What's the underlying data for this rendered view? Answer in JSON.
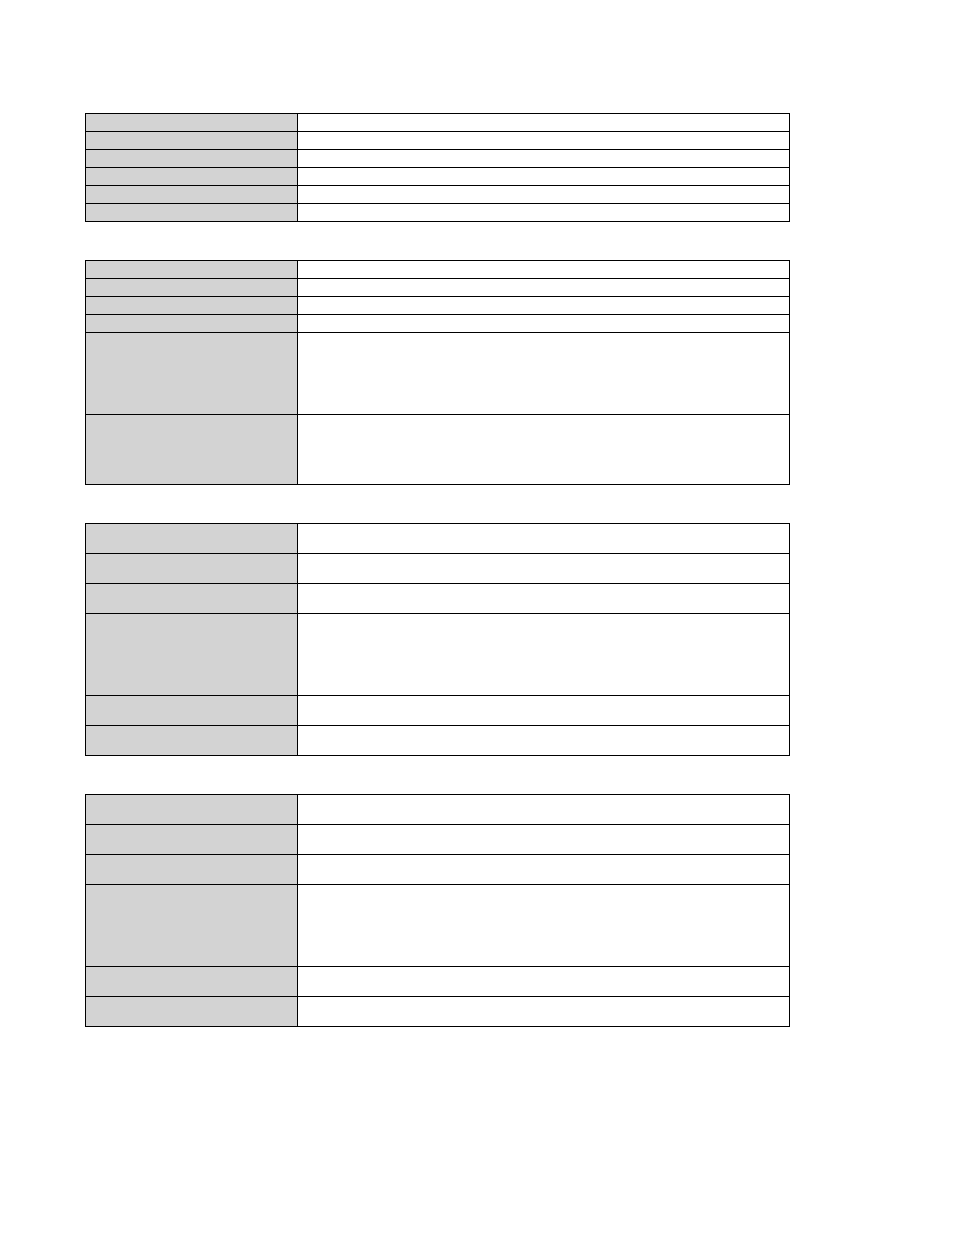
{
  "table1": {
    "rows": [
      {
        "label": "",
        "value": ""
      },
      {
        "label": "",
        "value": ""
      },
      {
        "label": "",
        "value": ""
      },
      {
        "label": "",
        "value": ""
      },
      {
        "label": "",
        "value": ""
      },
      {
        "label": "",
        "value": ""
      }
    ]
  },
  "table2": {
    "rows": [
      {
        "label": "",
        "value": ""
      },
      {
        "label": "",
        "value": ""
      },
      {
        "label": "",
        "value": ""
      },
      {
        "label": "",
        "value": ""
      },
      {
        "label": "",
        "value": ""
      },
      {
        "label": "",
        "value": ""
      }
    ]
  },
  "table3": {
    "rows": [
      {
        "label": "",
        "value": ""
      },
      {
        "label": "",
        "value": ""
      },
      {
        "label": "",
        "value": ""
      },
      {
        "label": "",
        "value": ""
      },
      {
        "label": "",
        "value": ""
      },
      {
        "label": "",
        "value": ""
      }
    ]
  },
  "table4": {
    "rows": [
      {
        "label": "",
        "value": ""
      },
      {
        "label": "",
        "value": ""
      },
      {
        "label": "",
        "value": ""
      },
      {
        "label": "",
        "value": ""
      },
      {
        "label": "",
        "value": ""
      },
      {
        "label": "",
        "value": ""
      }
    ]
  }
}
